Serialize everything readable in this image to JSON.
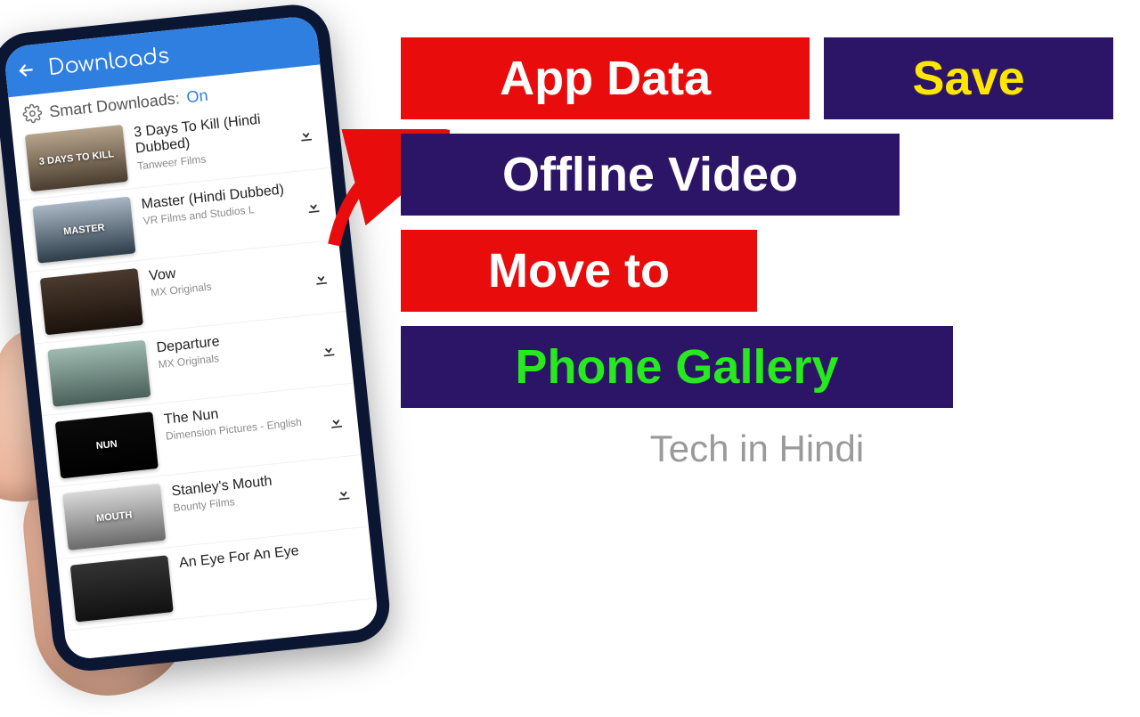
{
  "phone": {
    "appbar_title": "Downloads",
    "smart_label": "Smart Downloads:",
    "smart_value": "On",
    "items": [
      {
        "title": "3 Days To Kill (Hindi Dubbed)",
        "subtitle": "Tanweer Films",
        "caption": "3 DAYS TO KILL"
      },
      {
        "title": "Master (Hindi Dubbed)",
        "subtitle": "VR Films and Studios L",
        "caption": "MASTER"
      },
      {
        "title": "Vow",
        "subtitle": "MX Originals",
        "caption": ""
      },
      {
        "title": "Departure",
        "subtitle": "MX Originals",
        "caption": ""
      },
      {
        "title": "The Nun",
        "subtitle": "Dimension Pictures - English",
        "caption": "NUN"
      },
      {
        "title": "Stanley's Mouth",
        "subtitle": "Bounty Films",
        "caption": "MOUTH"
      },
      {
        "title": "An Eye For An Eye",
        "subtitle": "",
        "caption": ""
      }
    ]
  },
  "banners": {
    "app_data": "App Data",
    "save": "Save",
    "offline": "Offline Video",
    "move_to": "Move to",
    "gallery": "Phone Gallery"
  },
  "subtitle": "Tech in Hindi",
  "colors": {
    "red": "#e90c0c",
    "blue": "#2c1566",
    "yellow": "#ffe600",
    "green": "#28e820",
    "app_blue": "#2f7fe0"
  }
}
